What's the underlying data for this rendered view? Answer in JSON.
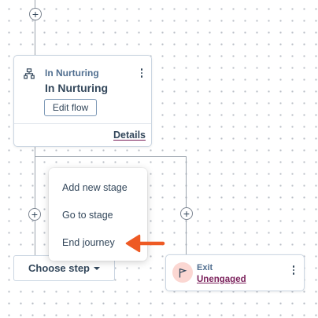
{
  "colors": {
    "connector": "#9aa3ad",
    "text": "#33475b",
    "link_underline": "#7a1f5a",
    "exit_icon_bg": "#fbd7d2",
    "arrow": "#ee5a24"
  },
  "flow_node": {
    "icon": "branch-icon",
    "label": "In Nurturing",
    "title": "In Nurturing",
    "edit_label": "Edit flow",
    "details_label": "Details"
  },
  "menu": {
    "items": [
      {
        "label": "Add new stage"
      },
      {
        "label": "Go to stage"
      },
      {
        "label": "End journey"
      }
    ]
  },
  "choose_step": {
    "label": "Choose step"
  },
  "exit_node": {
    "icon": "flag-icon",
    "label": "Exit",
    "value": "Unengaged"
  }
}
